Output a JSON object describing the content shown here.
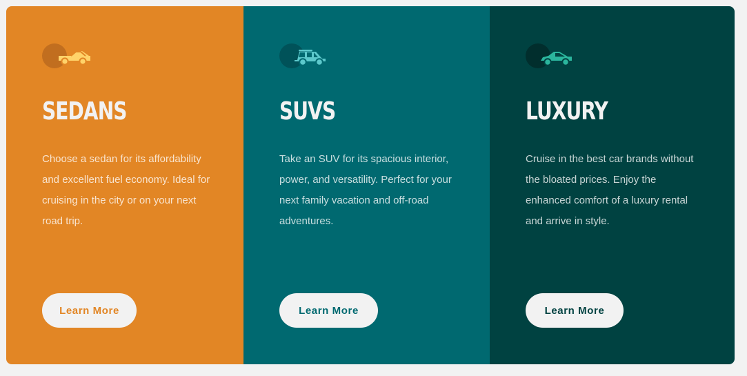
{
  "colors": {
    "sedans": "#e28625",
    "suvs": "#006970",
    "luxury": "#004241",
    "background": "#f2f2f2"
  },
  "cards": [
    {
      "id": "sedans",
      "title": "SEDANS",
      "description": "Choose a sedan for its affordability and excellent fuel economy. Ideal for cruising in the city or on your next road trip.",
      "button": "Learn More",
      "icon": "sedan-car-icon"
    },
    {
      "id": "suvs",
      "title": "SUVS",
      "description": "Take an SUV for its spacious interior, power, and versatility. Perfect for your next family vacation and off-road adventures.",
      "button": "Learn More",
      "icon": "suv-car-icon"
    },
    {
      "id": "luxury",
      "title": "LUXURY",
      "description": "Cruise in the best car brands without the bloated prices. Enjoy the enhanced comfort of a luxury rental and arrive in style.",
      "button": "Learn More",
      "icon": "luxury-car-icon"
    }
  ]
}
